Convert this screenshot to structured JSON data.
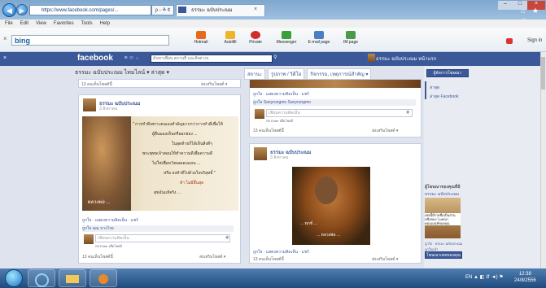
{
  "browser": {
    "address": "https://www.facebook.com/pages/...",
    "address_ctrl": "ρ - ≙ ¢",
    "tab_title": "ธรรมะ ฉบับประณม",
    "tab_close": "×",
    "window_controls": [
      "–",
      "□",
      "×"
    ],
    "home_icons": "⌂ ★ ☼",
    "menu": [
      "File",
      "Edit",
      "View",
      "Favorites",
      "Tools",
      "Help"
    ]
  },
  "bingbar": {
    "close": "×",
    "logo": "bing",
    "tools": [
      {
        "label": "Hotmail",
        "color": "#e86a1b"
      },
      {
        "label": "Autofill",
        "color": "#f0b429"
      },
      {
        "label": "Private",
        "color": "#d12b2b"
      },
      {
        "label": "Messenger",
        "color": "#3aa13a"
      },
      {
        "label": "E-mail page",
        "color": "#4a7fc1"
      },
      {
        "label": "IM page",
        "color": "#4a9a4a"
      }
    ],
    "signin": "Sign in"
  },
  "facebook": {
    "logo": "facebook",
    "search_placeholder": "ค้นหาเพื่อน สถานที่ และสิ่งต่างๆ",
    "user": "ธรรมะ ฉบับประณม   หน้าแรก",
    "page_title": "ธรรมะ ฉบับประณม   ไทมไลน์ ▾   ล่าสุด ▾",
    "actions": [
      "สถานะ",
      "รูปภาพ / วิดีโอ",
      "กิจกรรม, เหตุการณ์สำคัญ ▾"
    ]
  },
  "posts": {
    "left_top_count": "13 คนเห็นโพสต์นี้",
    "left_top_share": "ส่งเสริมโพสต์ ▾",
    "left_card": {
      "name": "ธรรมะ ฉบับประณม",
      "date": "3 สิงหาคม",
      "quote_lines": [
        "\" การทำดีเพราะตนเองสำคัญมากกว่าการทำดีเพื่อให้",
        "ผู้อื่นมองเห็นหรือยกย่อง ...",
        "ในสุดท้ายก็ได้เห็นสิ่งดีๆ",
        "พระพุทธเจ้าสอนให้ทำความดีเพื่อความดี",
        "ไม่ใช่เพื่อหวังผลตอบแทน ...",
        "หรือ จงทำดีไปด้วยใจบริสุทธิ์ \"",
        "ทำ ไม่มีสิ้นสุด",
        "สุขอันแท้จริง ..."
      ],
      "signature": "หลวงพ่อ ...",
      "links": "ถูกใจ · แสดงความคิดเห็น · แชร์",
      "liked": "ถูกใจ คุณ บางไรย",
      "comment_placeholder": "เขียนความคิดเห็น",
      "comment_hint": "กด Enter เพื่อโพสต์",
      "count": "13 คนเห็นโพสต์นี้",
      "share": "ส่งเสริมโพสต์ ▾"
    },
    "mid_top": {
      "links": "ถูกใจ · แสดงความคิดเห็น · แชร์",
      "liked": "ถูกใจ Sanyrungmo Sanyrungmo",
      "comment_placeholder": "เขียนความคิดเห็น",
      "comment_hint": "กด Enter เพื่อโพสต์",
      "count": "13 คนเห็นโพสต์นี้",
      "share": "ส่งเสริมโพสต์ ▾"
    },
    "mid_card": {
      "name": "ธรรมะ ฉบับประณม",
      "date": "3 สิงหาคม",
      "caption_lines": [
        "... ทุกข์ ...",
        "... หลวงพ่อ ..."
      ],
      "links": "ถูกใจ · แสดงความคิดเห็น · แชร์",
      "count": "13 คนเห็นโพสต์นี้",
      "share": "ส่งเสริมโพสต์ ▾"
    }
  },
  "sidebar": {
    "manage_btn": "ผู้จัดการโฆษณา",
    "items": [
      "ล่าสุด",
      "ล่าสุด Facebook"
    ],
    "promo_title": "ผู้โฆษณาของคุณที่มี",
    "promo_page": "ธรรมะ ฉบับประณม",
    "promo_text": "เพจนี้มีรายชื่อเป็นส่วนหนึ่งของ โฆษณา คอมเมนท์ของคุณ",
    "promo_like": "ถูกใจ · ธรรมะ ฉบับประณม ถูกใจแล้ว",
    "promo_btn": "โฆษณาเพจของคุณ"
  },
  "taskbar": {
    "tray": "EN  ▲  ◧  ⇵  ◄)  ⚑",
    "time": "12:38",
    "date": "24/8/2556"
  }
}
